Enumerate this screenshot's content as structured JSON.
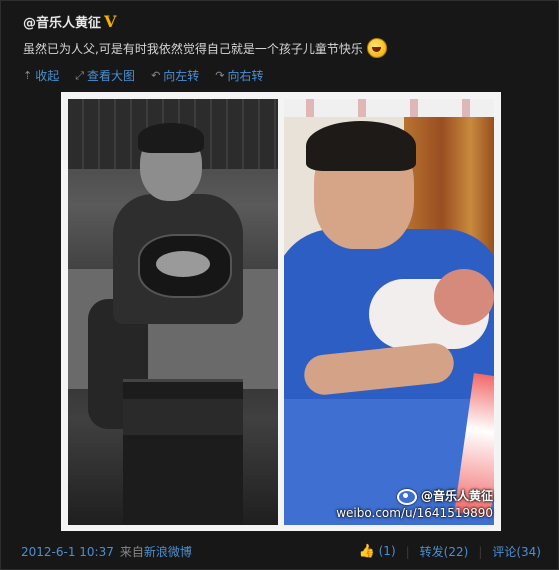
{
  "post": {
    "username": "@音乐人黄征",
    "verified_badge": "V",
    "text": "虽然已为人父,可是有时我依然觉得自己就是一个孩子儿童节快乐",
    "emoji": "laughing-emoji"
  },
  "toolbar": {
    "collapse": "收起",
    "view_large": "查看大图",
    "rotate_left": "向左转",
    "rotate_right": "向右转"
  },
  "watermark": {
    "name": "@音乐人黄征",
    "url": "weibo.com/u/1641519890"
  },
  "footer": {
    "timestamp": "2012-6-1 10:37",
    "from_label": "来自",
    "source": "新浪微博",
    "like_count": "(1)",
    "repost": "转发(22)",
    "comment": "评论(34)",
    "separator": "|"
  },
  "colors": {
    "background": "#161616",
    "link": "#4b8fd1",
    "verified": "#f2b200"
  }
}
